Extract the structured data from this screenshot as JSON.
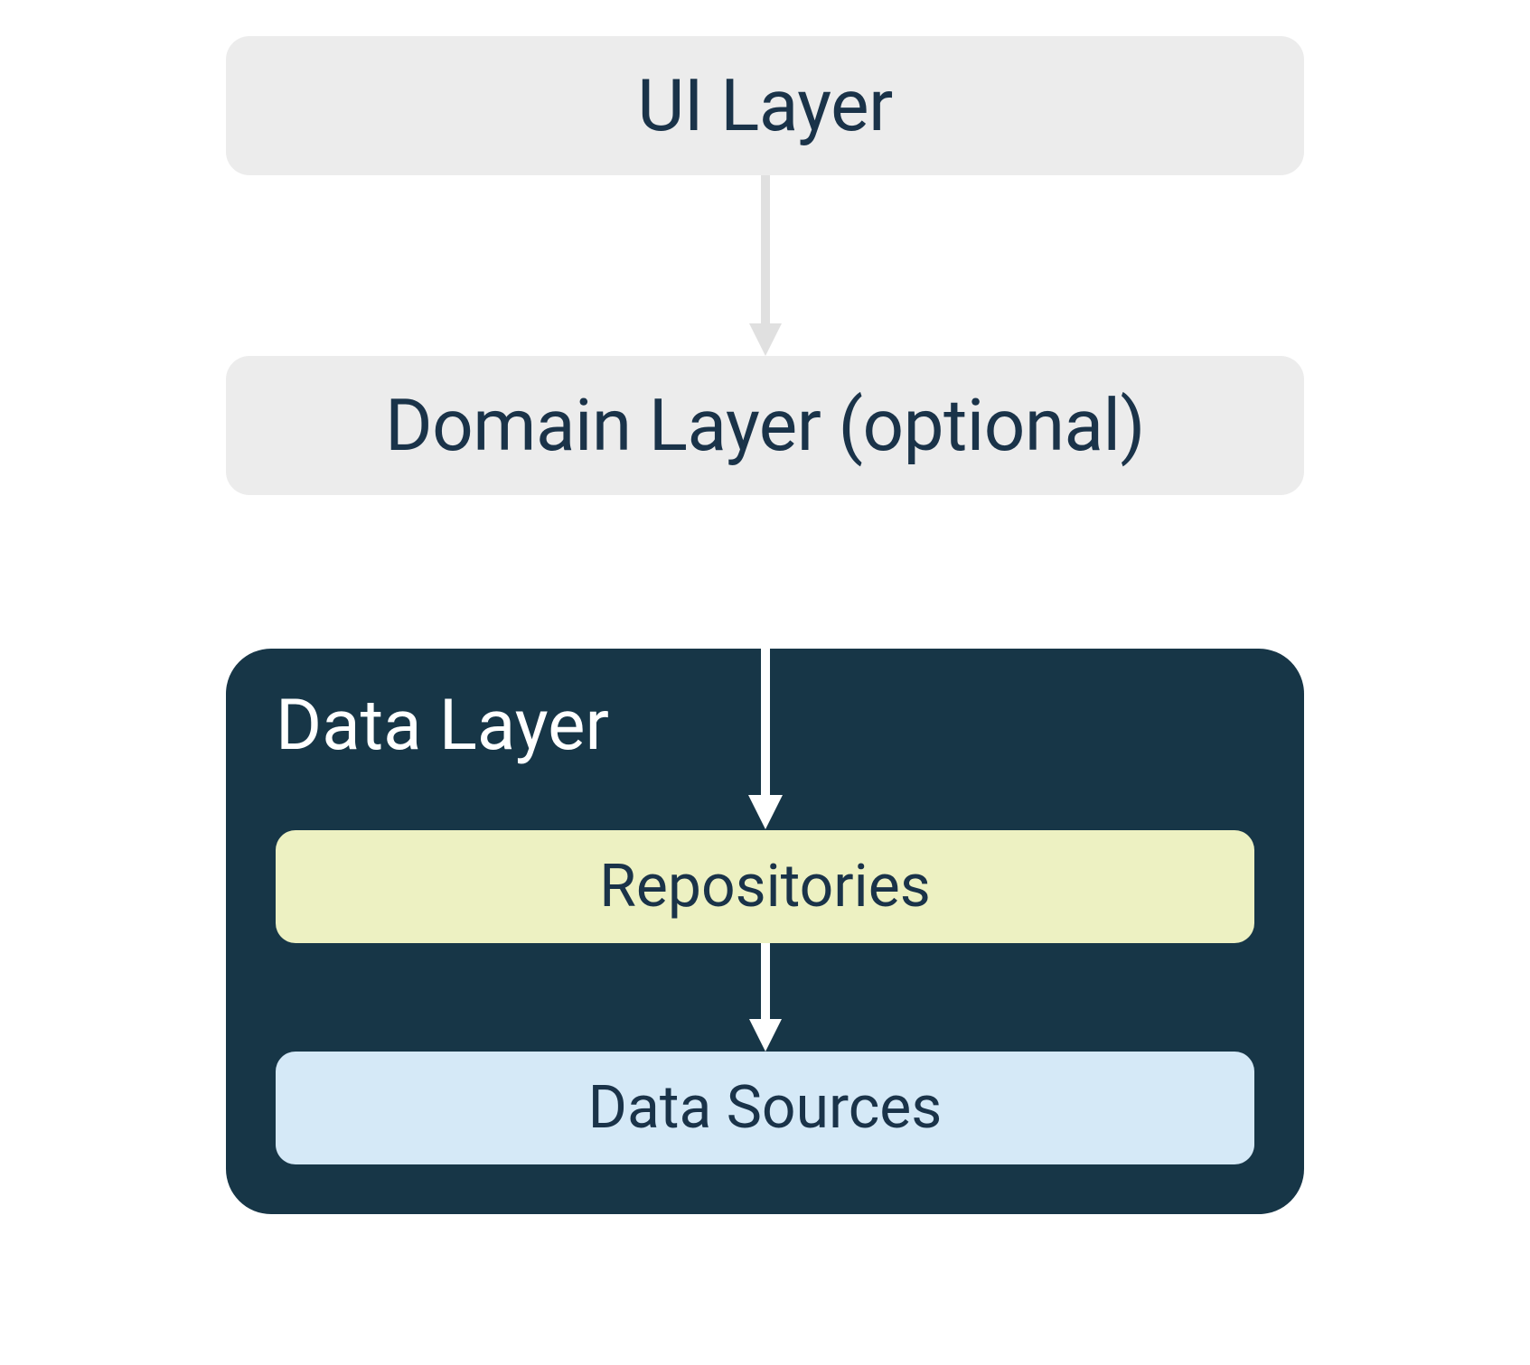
{
  "layers": {
    "ui": "UI Layer",
    "domain": "Domain Layer (optional)",
    "data_title": "Data Layer",
    "repositories": "Repositories",
    "data_sources": "Data Sources"
  },
  "colors": {
    "box_bg": "#ececec",
    "box_text": "#1a3349",
    "data_layer_bg": "#173647",
    "data_layer_text": "#ffffff",
    "repositories_bg": "#edf1c2",
    "data_sources_bg": "#d5e9f7",
    "outer_arrow": "#e0e0e0",
    "inner_arrow": "#ffffff"
  }
}
